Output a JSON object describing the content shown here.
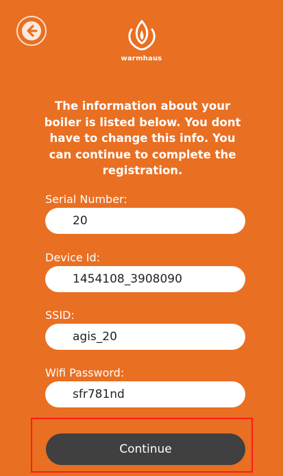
{
  "brand": {
    "name": "warmhaus",
    "logo_icon": "flame-logo-icon"
  },
  "header": {
    "back_icon": "arrow-left-icon"
  },
  "intro": {
    "text": "The information about your boiler is listed below. You dont have to change this info. You can continue to complete the registration."
  },
  "fields": {
    "serial": {
      "label": "Serial Number:",
      "value": "20"
    },
    "device": {
      "label": "Device Id:",
      "value": "1454108_3908090"
    },
    "ssid": {
      "label": "SSID:",
      "value": "agis_20"
    },
    "password": {
      "label": "Wifi Password:",
      "value": "sfr781nd"
    }
  },
  "actions": {
    "continue_label": "Continue"
  },
  "colors": {
    "background": "#E96F22",
    "button": "#404040",
    "highlight": "#FF1A1A",
    "input": "#FFFFFF"
  }
}
